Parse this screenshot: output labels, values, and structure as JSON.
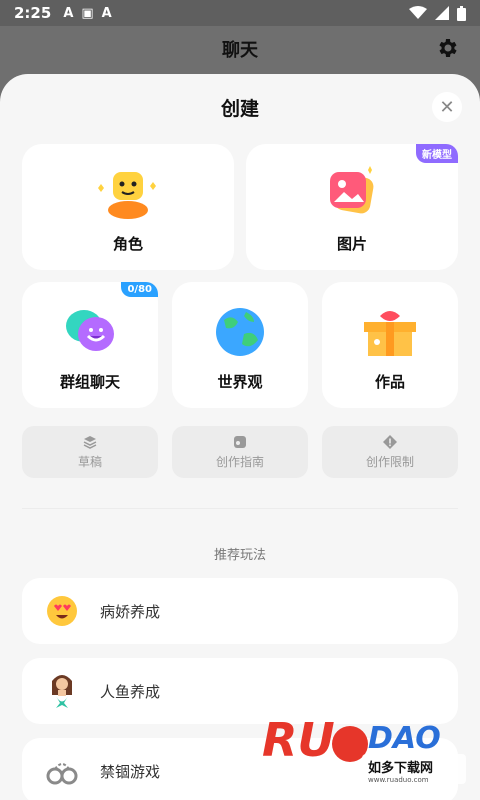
{
  "status_bar": {
    "time": "2:25",
    "notifications": [
      "A",
      "▣",
      "A"
    ]
  },
  "app_bar": {
    "title": "聊天"
  },
  "sheet": {
    "title": "创建",
    "cards": [
      {
        "label": "角色"
      },
      {
        "label": "图片",
        "badge": "新模型"
      },
      {
        "label": "群组聊天",
        "badge": "0/80"
      },
      {
        "label": "世界观"
      },
      {
        "label": "作品"
      }
    ],
    "small_buttons": [
      {
        "label": "草稿",
        "icon": "layers-icon"
      },
      {
        "label": "创作指南",
        "icon": "guide-icon"
      },
      {
        "label": "创作限制",
        "icon": "warning-icon"
      }
    ],
    "section_title": "推荐玩法",
    "recommendations": [
      {
        "label": "病娇养成",
        "icon": "heart-eyes-emoji-icon"
      },
      {
        "label": "人鱼养成",
        "icon": "mermaid-icon"
      },
      {
        "label": "禁锢游戏",
        "icon": "handcuffs-icon"
      }
    ]
  },
  "watermark": {
    "brand": "RUANDAO",
    "cn_text": "如多下载网",
    "url": "www.ruaduo.com"
  },
  "colors": {
    "accent_blue": "#2aa1ff",
    "accent_purple": "#8f6bff",
    "watermark_red": "#e6362a",
    "watermark_blue": "#2a6fd8"
  }
}
